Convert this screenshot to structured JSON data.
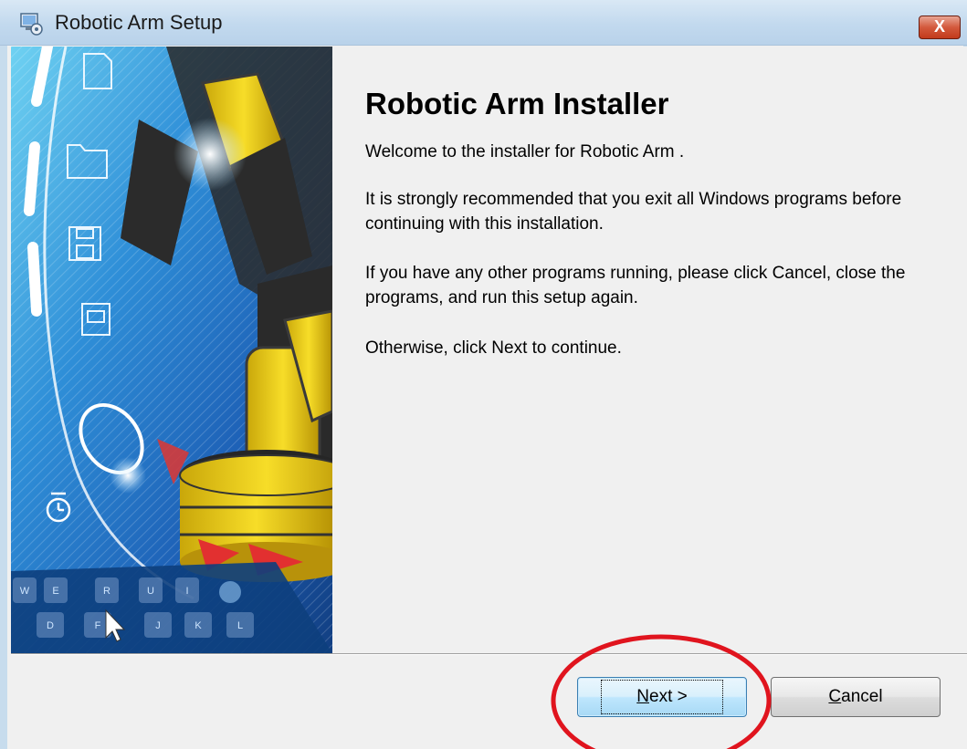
{
  "window": {
    "title": "Robotic Arm Setup",
    "close_label": "X",
    "app_icon": "installer-computer-icon"
  },
  "banner": {
    "description_icons": [
      "document-icon",
      "folder-icon",
      "floppy-disk-icon",
      "text-document-icon",
      "mouse-icon",
      "timer-icon"
    ],
    "keyboard_keys_row1": [
      "W",
      "E",
      "R",
      "U",
      "I"
    ],
    "keyboard_keys_row2": [
      "D",
      "F",
      "J",
      "K",
      "L"
    ]
  },
  "content": {
    "heading": "Robotic Arm Installer",
    "welcome": "Welcome to the installer for Robotic Arm .",
    "recommend": "It is strongly recommended that you exit all Windows programs before continuing with this installation.",
    "other_programs": "If you have any other programs running, please click Cancel, close the programs, and run this setup again.",
    "otherwise": "Otherwise, click Next to continue."
  },
  "buttons": {
    "next_mnemonic": "N",
    "next_rest": "ext >",
    "cancel_mnemonic": "C",
    "cancel_rest": "ancel"
  },
  "colors": {
    "annotation_circle": "#e0141e",
    "banner_blue": "#1560b8",
    "robot_yellow": "#f3d417"
  }
}
